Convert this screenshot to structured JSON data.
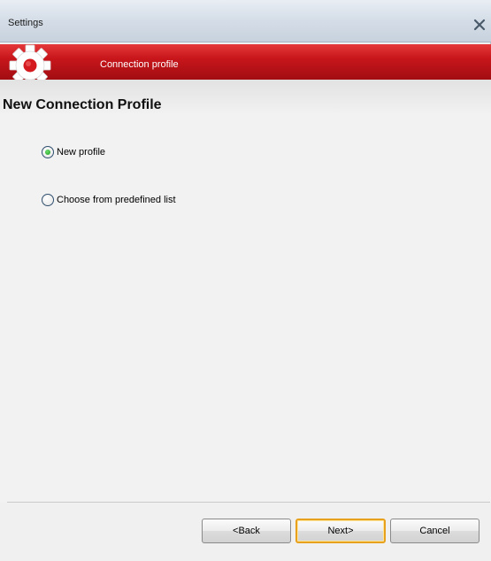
{
  "window": {
    "title": "Settings",
    "close_icon": "close-icon"
  },
  "banner": {
    "icon": "gear-icon",
    "label": "Connection profile",
    "colors": {
      "top": "#e5383a",
      "bottom": "#a10d12"
    }
  },
  "content": {
    "heading": "New Connection Profile",
    "options": [
      {
        "label": "New profile",
        "selected": true
      },
      {
        "label": "Choose from predefined list",
        "selected": false
      }
    ]
  },
  "footer": {
    "back_label": "<Back",
    "next_label": "Next>",
    "cancel_label": "Cancel",
    "default_button_color": "#e8a11d"
  }
}
